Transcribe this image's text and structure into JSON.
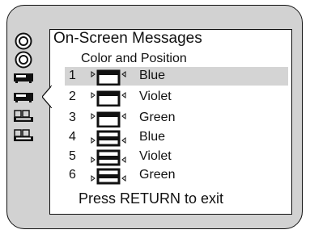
{
  "menu": {
    "title": "On-Screen Messages",
    "subtitle": "Color and Position",
    "footer": "Press RETURN to exit"
  },
  "sidebar": {
    "icons": [
      "disc-icon",
      "disc-icon",
      "vcr-icon",
      "vcr-icon",
      "camcorder-icon",
      "camcorder-icon"
    ],
    "selected_index": 3
  },
  "options": [
    {
      "number": "1",
      "label": "Blue",
      "icon": "screen-position-icon",
      "selected": true
    },
    {
      "number": "2",
      "label": "Violet",
      "icon": "screen-position-icon",
      "selected": false
    },
    {
      "number": "3",
      "label": "Green",
      "icon": "screen-position-icon",
      "selected": false
    },
    {
      "number": "4",
      "label": "Blue",
      "icon": "screen-position-icon",
      "selected": false
    },
    {
      "number": "5",
      "label": "Violet",
      "icon": "screen-position-icon",
      "selected": false
    },
    {
      "number": "6",
      "label": "Green",
      "icon": "screen-position-icon",
      "selected": false
    }
  ],
  "colors": {
    "screen_background": "#d2d2d2",
    "panel_background": "#ffffff",
    "selected_row": "#d4d4d4"
  }
}
